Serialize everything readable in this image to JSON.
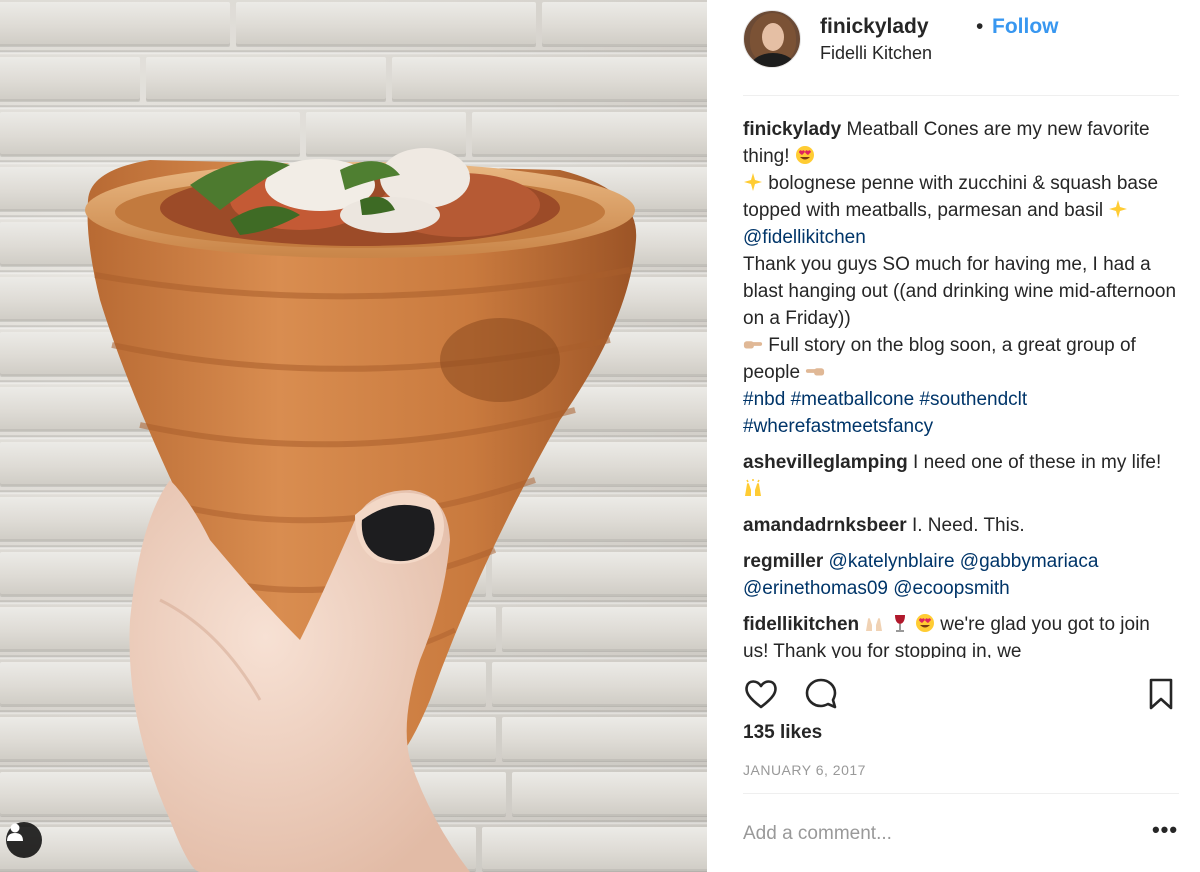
{
  "post": {
    "username": "finickylady",
    "separator": "•",
    "follow_label": "Follow",
    "location": "Fidelli Kitchen",
    "photo_tag_icon": "user-tag-icon"
  },
  "caption": {
    "username": "finickylady",
    "line1": "Meatball Cones are my new favorite thing!",
    "line2": "bolognese penne with zucchini & squash base topped with meatballs, parmesan and basil",
    "mention": "@fidellikitchen",
    "line3": "Thank you guys SO much for having me, I had a blast hanging out ((and drinking wine mid-afternoon on a Friday))",
    "line4": "Full story on the blog soon, a great group of people",
    "hashtags": [
      "#nbd",
      "#meatballcone",
      "#southendclt",
      "#wherefastmeetsfancy"
    ]
  },
  "comments": [
    {
      "username": "ashevilleglamping",
      "text": "I need one of these in my life!"
    },
    {
      "username": "amandadrnksbeer",
      "text": "I. Need. This."
    },
    {
      "username": "regmiller",
      "mentions": [
        "@katelynblaire",
        "@gabbymariaca",
        "@erinethomas09",
        "@ecoopsmith"
      ]
    },
    {
      "username": "fidellikitchen",
      "text": "we're glad you got to join us! Thank you for stopping in, we"
    }
  ],
  "actions": {
    "like_icon": "heart-icon",
    "comment_icon": "speech-bubble-icon",
    "save_icon": "bookmark-icon"
  },
  "likes": "135 likes",
  "date": "JANUARY 6, 2017",
  "add_comment": {
    "placeholder": "Add a comment...",
    "more": "•••"
  },
  "colors": {
    "link_blue": "#3897f0",
    "mention_navy": "#003569",
    "meta_gray": "#999999",
    "text": "#262626"
  }
}
